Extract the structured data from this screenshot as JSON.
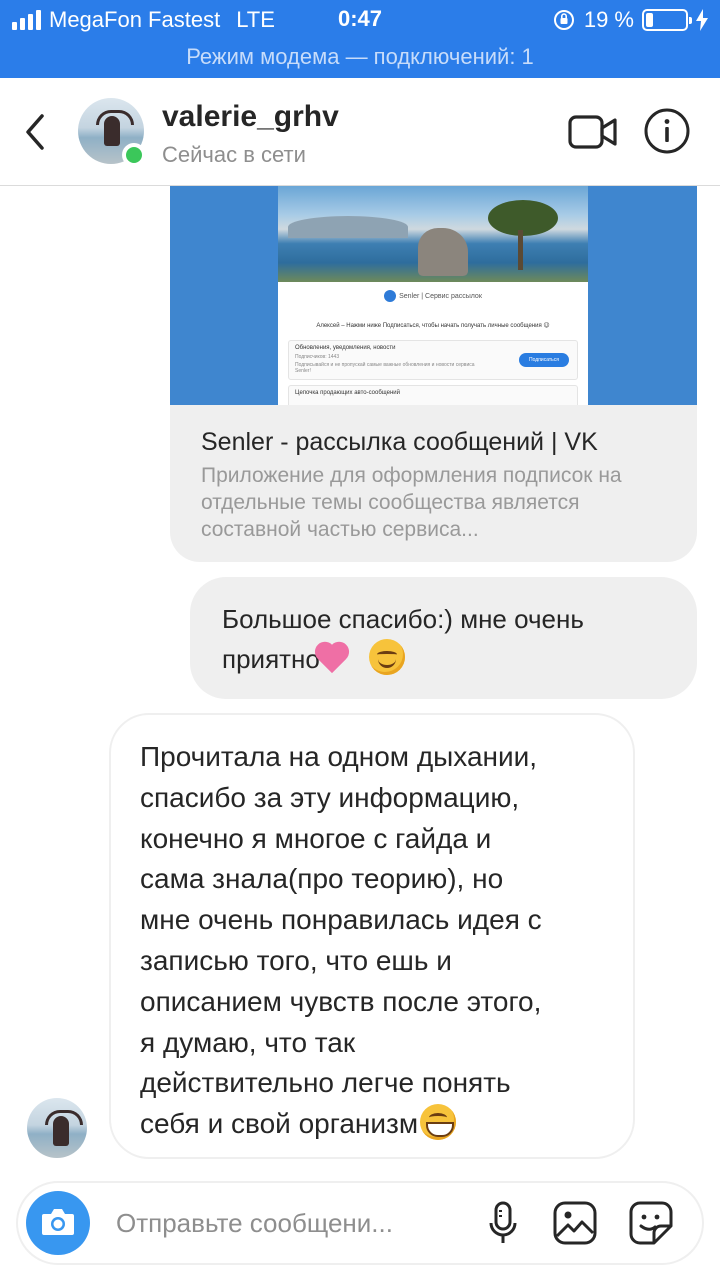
{
  "status_bar": {
    "carrier": "MegaFon Fastest",
    "network": "LTE",
    "time": "0:47",
    "battery_percent": "19 %",
    "battery_level": 0.19,
    "signal_bars": 4
  },
  "hotspot_banner": "Режим модема — подключений: 1",
  "header": {
    "username": "valerie_grhv",
    "status": "Сейчас в сети",
    "icons": [
      "back-chevron-icon",
      "video-call-icon",
      "info-icon"
    ]
  },
  "link_preview": {
    "title": "Senler - рассылка сообщений | VK",
    "description": "Приложение для оформления подписок на отдельные темы сообщества является составной частью сервиса...",
    "screenshot": {
      "brand": "Senler | Сервис рассылок",
      "greeting": "Алексей – Нажми ниже Подписаться, чтобы начать получать личные сообщения 😉",
      "row1_title": "Обновления, уведомления, новости",
      "row1_subs": "Подписчиков: 1443",
      "row1_desc": "Подписывайся и не пропускай самые важные обновления и новости сервиса Senler!",
      "row1_button": "Подписаться",
      "row2_title": "Цепочка продающих авто-сообщений"
    }
  },
  "messages": [
    {
      "direction": "outgoing",
      "text": "Большое спасибо:) мне очень приятно"
    },
    {
      "direction": "incoming",
      "lines": [
        "Прочитала на одном дыхании,",
        "спасибо за эту информацию,",
        "конечно я многое с гайда и",
        "сама знала(про теорию), но",
        "мне очень понравилась идея с",
        "записью того, что ешь и",
        "описанием чувств после этого,",
        "я думаю, что так",
        "действительно легче понять",
        "себя и свой организм"
      ]
    }
  ],
  "composer": {
    "placeholder": "Отправьте сообщени...",
    "value": "",
    "icons": [
      "camera-icon",
      "microphone-icon",
      "gallery-icon",
      "sticker-icon"
    ]
  },
  "colors": {
    "status_bar_bg": "#2b7de9",
    "online_dot": "#3bc75a",
    "camera_button": "#3897f0",
    "bubble_gray": "#efefef"
  }
}
